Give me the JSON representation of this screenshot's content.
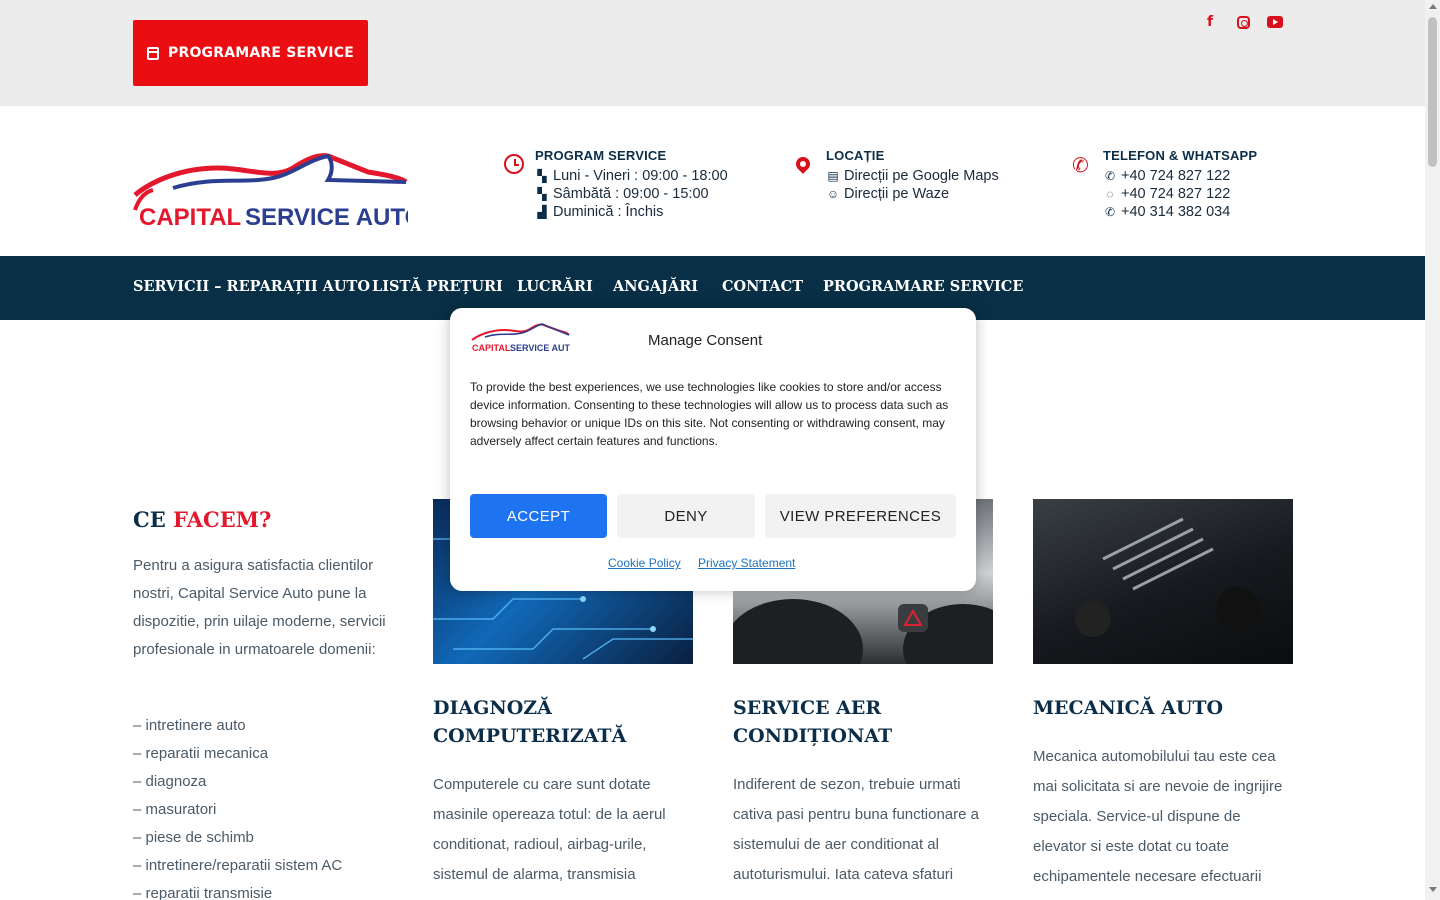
{
  "topbar": {
    "button_label": "PROGRAMARE SERVICE",
    "social": [
      "facebook-icon",
      "instagram-icon",
      "youtube-icon"
    ]
  },
  "logo": {
    "line1": "CAPITAL SERVICE AUTO"
  },
  "info": {
    "program": {
      "title": "PROGRAM SERVICE",
      "lines": [
        "Luni - Vineri : 09:00 - 18:00",
        "Sâmbătă : 09:00 - 15:00",
        "Duminică : Închis"
      ]
    },
    "locatie": {
      "title": "LOCAȚIE",
      "lines": [
        "Direcții pe Google Maps",
        "Direcții pe Waze"
      ]
    },
    "telefon": {
      "title": "TELEFON & WHATSAPP",
      "lines": [
        "+40 724 827 122",
        "+40 724 827 122",
        "+40 314 382 034"
      ]
    }
  },
  "nav": {
    "items": [
      "SERVICII – REPARAȚII AUTO",
      "LISTĂ PREȚURI",
      "LUCRĂRI",
      "ANGAJĂRI",
      "CONTACT",
      "PROGRAMARE SERVICE"
    ]
  },
  "section": {
    "title_part1": "CE ",
    "title_part2": "FACEM?",
    "intro": "Pentru a asigura satisfactia clientilor nostri, Capital Service Auto pune la dispozitie, prin uilaje moderne, servicii profesionale in urmatoarele domenii:",
    "list": [
      "– intretinere auto",
      "– reparatii mecanica",
      "– diagnoza",
      "– masuratori",
      "– piese de schimb",
      "– intretinere/reparatii sistem AC",
      "– reparatii transmisie"
    ]
  },
  "cards": [
    {
      "title": "DIAGNOZĂ COMPUTERIZATĂ",
      "text": "Computerele cu care sunt dotate masinile opereaza totul: de la aerul conditionat, radioul, airbag-urile, sistemul de alarma, transmisia"
    },
    {
      "title": "SERVICE AER CONDIȚIONAT",
      "text": "Indiferent de sezon, trebuie urmati cativa pasi pentru buna functionare a sistemului de aer conditionat al autoturismului. Iata cateva sfaturi"
    },
    {
      "title": "MECANICĂ AUTO",
      "text": "Mecanica automobilului tau este cea mai solicitata si are nevoie de ingrijire speciala. Service-ul dispune de elevator si este dotat cu toate echipamentele necesare efectuarii"
    }
  ],
  "consent": {
    "title": "Manage Consent",
    "text": "To provide the best experiences, we use technologies like cookies to store and/or access device information. Consenting to these technologies will allow us to process data such as browsing behavior or unique IDs on this site. Not consenting or withdrawing consent, may adversely affect certain features and functions.",
    "accept": "ACCEPT",
    "deny": "DENY",
    "view": "VIEW PREFERENCES",
    "cookie_policy": "Cookie Policy",
    "privacy": "Privacy Statement"
  },
  "colors": {
    "brand_red": "#ea0d12",
    "nav_bg": "#082f45",
    "accept_blue": "#1e73f0",
    "title_navy": "#0b2d48"
  }
}
